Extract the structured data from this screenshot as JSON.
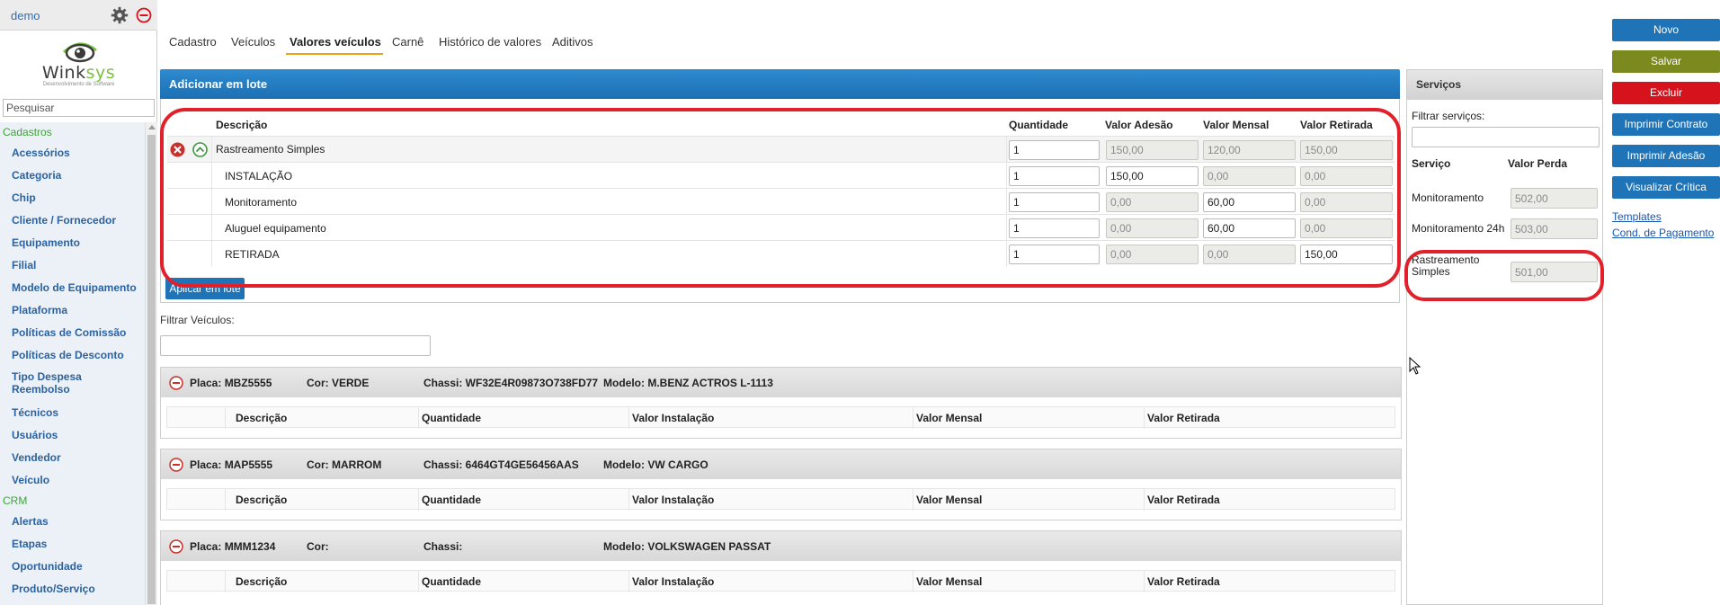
{
  "sidebar": {
    "user": "demo",
    "logo": {
      "brand_main": "Wink",
      "brand_accent": "sys",
      "tagline": "Desenvolvimento de Software"
    },
    "search_placeholder": "Pesquisar",
    "sections": [
      {
        "label": "Cadastros",
        "items": [
          "Acessórios",
          "Categoria",
          "Chip",
          "Cliente / Fornecedor",
          "Equipamento",
          "Filial",
          "Modelo de Equipamento",
          "Plataforma",
          "Políticas de Comissão",
          "Políticas de Desconto",
          "Tipo Despesa Reembolso",
          "Técnicos",
          "Usuários",
          "Vendedor",
          "Veículo"
        ]
      },
      {
        "label": "CRM",
        "items": [
          "Alertas",
          "Etapas",
          "Oportunidade",
          "Produto/Serviço"
        ]
      }
    ]
  },
  "tabs": [
    "Cadastro",
    "Veículos",
    "Valores veículos",
    "Carnê",
    "Histórico de valores",
    "Aditivos"
  ],
  "active_tab": "Valores veículos",
  "lote": {
    "title": "Adicionar em lote",
    "columns": [
      "Descrição",
      "Quantidade",
      "Valor Adesão",
      "Valor Mensal",
      "Valor Retirada"
    ],
    "rows": [
      {
        "desc": "Rastreamento Simples",
        "qtd": "1",
        "adesao": "150,00",
        "mensal": "120,00",
        "retirada": "150,00"
      },
      {
        "desc": "INSTALAÇÃO",
        "qtd": "1",
        "adesao": "150,00",
        "mensal": "0,00",
        "retirada": "0,00"
      },
      {
        "desc": "Monitoramento",
        "qtd": "1",
        "adesao": "0,00",
        "mensal": "60,00",
        "retirada": "0,00"
      },
      {
        "desc": "Aluguel equipamento",
        "qtd": "1",
        "adesao": "0,00",
        "mensal": "60,00",
        "retirada": "0,00"
      },
      {
        "desc": "RETIRADA",
        "qtd": "1",
        "adesao": "0,00",
        "mensal": "0,00",
        "retirada": "150,00"
      }
    ],
    "apply_label": "Aplicar em lote"
  },
  "vehicles": {
    "filter_label": "Filtrar Veículos:",
    "columns": [
      "Descrição",
      "Quantidade",
      "Valor Instalação",
      "Valor Mensal",
      "Valor Retirada"
    ],
    "items": [
      {
        "placa": "Placa: MBZ5555",
        "cor": "Cor: VERDE",
        "chassi": "Chassi: WF32E4R09873O738FD77",
        "modelo": "Modelo: M.BENZ ACTROS L-1113"
      },
      {
        "placa": "Placa: MAP5555",
        "cor": "Cor: MARROM",
        "chassi": "Chassi: 6464GT4GE56456AAS",
        "modelo": "Modelo: VW CARGO"
      },
      {
        "placa": "Placa: MMM1234",
        "cor": "Cor:",
        "chassi": "Chassi:",
        "modelo": "Modelo: VOLKSWAGEN PASSAT"
      }
    ]
  },
  "services": {
    "title": "Serviços",
    "filter_label": "Filtrar serviços:",
    "col_service": "Serviço",
    "col_value": "Valor Perda",
    "items": [
      {
        "name": "Monitoramento",
        "value": "502,00"
      },
      {
        "name": "Monitoramento 24h",
        "value": "503,00"
      },
      {
        "name": "Rastreamento Simples",
        "value": "501,00"
      }
    ]
  },
  "actions": {
    "new": "Novo",
    "save": "Salvar",
    "delete": "Excluir",
    "print_contract": "Imprimir Contrato",
    "print_adhesion": "Imprimir Adesão",
    "view_critical": "Visualizar Crítica",
    "templates": "Templates",
    "payment": "Cond. de Pagamento"
  },
  "colors": {
    "accent_blue": "#1f74b8",
    "olive": "#7b8a1f",
    "danger": "#d6121d",
    "highlight": "#e2202a",
    "tab_underline": "#e8a317",
    "menu_green": "#3fa33a"
  }
}
